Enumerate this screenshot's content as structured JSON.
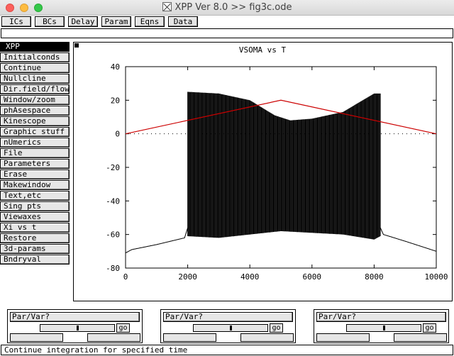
{
  "window": {
    "title": "XPP Ver 8.0 >> fig3c.ode"
  },
  "top_buttons": [
    {
      "name": "ics",
      "label": "ICs"
    },
    {
      "name": "bcs",
      "label": "BCs"
    },
    {
      "name": "delay",
      "label": "Delay"
    },
    {
      "name": "param",
      "label": "Param"
    },
    {
      "name": "eqns",
      "label": "Eqns"
    },
    {
      "name": "data",
      "label": "Data"
    }
  ],
  "command_line": {
    "value": ""
  },
  "main_menu": {
    "header": "XPP",
    "items": [
      "Initialconds",
      "Continue",
      "Nullcline",
      "Dir.field/flow",
      "Window/zoom",
      "phAsespace",
      "Kinescope",
      "Graphic stuff",
      "nUmerics",
      "File",
      "Parameters",
      "Erase",
      "Makewindow",
      "Text,etc",
      "Sing pts",
      "Viewaxes",
      "Xi vs t",
      "Restore",
      "3d-params",
      "Bndryval"
    ]
  },
  "plot": {
    "title": "VSOMA vs T"
  },
  "chart_data": {
    "type": "line",
    "title": "VSOMA vs T",
    "xlabel": "",
    "ylabel": "",
    "xlim": [
      0,
      10000
    ],
    "ylim": [
      -80,
      40
    ],
    "x_ticks": [
      "0",
      "2000",
      "4000",
      "6000",
      "8000",
      "10000"
    ],
    "y_ticks": [
      "40",
      "20",
      "0",
      "-20",
      "-40",
      "-60",
      "-80"
    ],
    "zero_line": "dotted",
    "series": [
      {
        "color": "#000000",
        "style": "spiking trace",
        "baseline_x": [
          0,
          200,
          1000,
          1900,
          2000,
          3000,
          4000,
          5000,
          6000,
          7000,
          8000,
          8200,
          8300,
          9000,
          10000
        ],
        "baseline_y": [
          -71,
          -69,
          -66,
          -62,
          -56,
          -57,
          -55,
          -53,
          -54,
          -55,
          -58,
          -56,
          -60,
          -64,
          -70
        ],
        "burst_start": 2000,
        "burst_end": 8200,
        "peak_x": [
          2000,
          3000,
          4000,
          4800,
          5300,
          6000,
          7000,
          8000,
          8200
        ],
        "peak_y": [
          25,
          24,
          20,
          11,
          8,
          9,
          13,
          24,
          24
        ]
      },
      {
        "color": "#cc0000",
        "style": "ramp",
        "x": [
          0,
          5000,
          10000
        ],
        "y": [
          0,
          20,
          0
        ]
      }
    ]
  },
  "controls": [
    {
      "label": "Par/Var?",
      "go_label": "go",
      "slider": 0.5
    },
    {
      "label": "Par/Var?",
      "go_label": "go",
      "slider": 0.5
    },
    {
      "label": "Par/Var?",
      "go_label": "go",
      "slider": 0.5
    }
  ],
  "status": {
    "text": "Continue integration for specified time"
  }
}
